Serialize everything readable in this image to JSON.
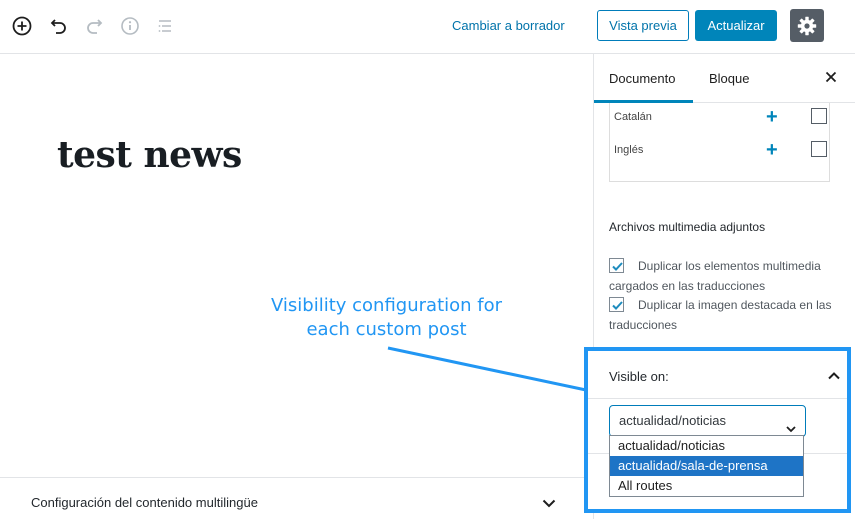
{
  "toolbar": {
    "switch_to_draft": "Cambiar a borrador",
    "preview": "Vista previa",
    "update": "Actualizar"
  },
  "editor": {
    "title": "test news"
  },
  "bottom_panel": {
    "label": "Configuración del contenido multilingüe"
  },
  "sidebar": {
    "tabs": [
      {
        "label": "Documento",
        "active": true
      },
      {
        "label": "Bloque",
        "active": false
      }
    ],
    "languages": [
      {
        "name": "Catalán",
        "checked": false
      },
      {
        "name": "Inglés",
        "checked": false
      }
    ],
    "media": {
      "heading": "Archivos multimedia adjuntos",
      "options": [
        {
          "label": "Duplicar los elementos multimedia cargados en las traducciones",
          "checked": true
        },
        {
          "label": "Duplicar la imagen destacada en las traducciones",
          "checked": true
        }
      ]
    },
    "visible_on": {
      "title": "Visible on:",
      "selected": "actualidad/noticias",
      "options": [
        "actualidad/noticias",
        "actualidad/sala-de-prensa",
        "All routes"
      ],
      "highlighted_option": "actualidad/sala-de-prensa"
    }
  },
  "annotation": {
    "text": "Visibility configuration for each custom post"
  },
  "colors": {
    "accent": "#0085ba",
    "link": "#0073aa",
    "annotation": "#2196f3",
    "settings_bg": "#555d66"
  }
}
